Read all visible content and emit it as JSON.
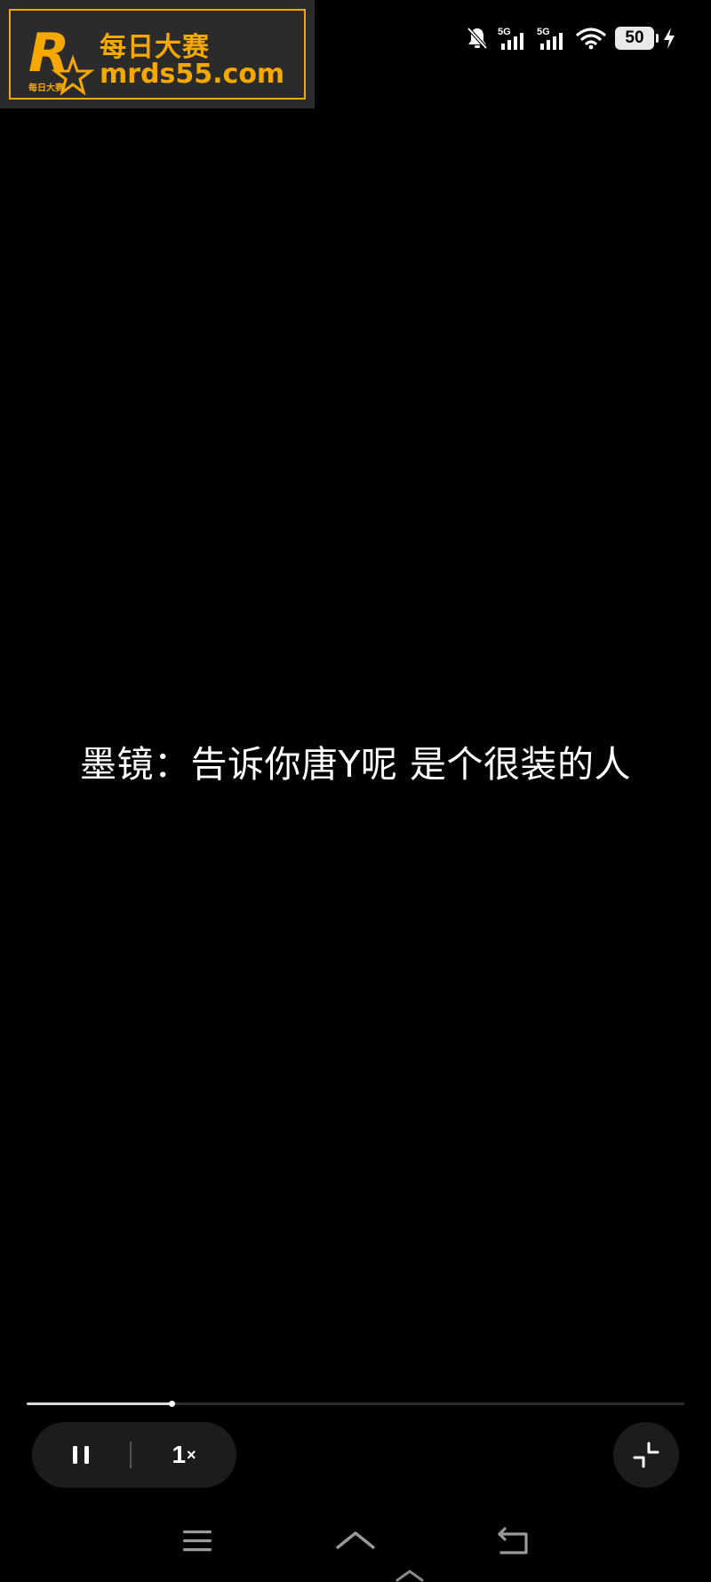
{
  "watermark": {
    "name_cn": "每日大赛",
    "url": "mrds55.com",
    "badge_text": "每日大赛",
    "accent_color": "#f5a800"
  },
  "status_bar": {
    "icons": [
      "bell-muted-icon",
      "5g-signal-icon",
      "5g-signal-icon",
      "wifi-icon",
      "battery-icon",
      "charging-icon"
    ],
    "network_1": "5G",
    "network_2": "5G",
    "battery_level": "50",
    "charging": true
  },
  "player": {
    "subtitle": "墨镜：告诉你唐Y呢 是个很装的人",
    "progress_fraction": 0.22,
    "speed_value": "1",
    "speed_suffix": "×",
    "pause_icon": "pause-icon",
    "minimize_icon": "minimize-icon"
  },
  "nav_bar": {
    "items": [
      "menu-icon",
      "home-icon",
      "back-icon"
    ]
  }
}
